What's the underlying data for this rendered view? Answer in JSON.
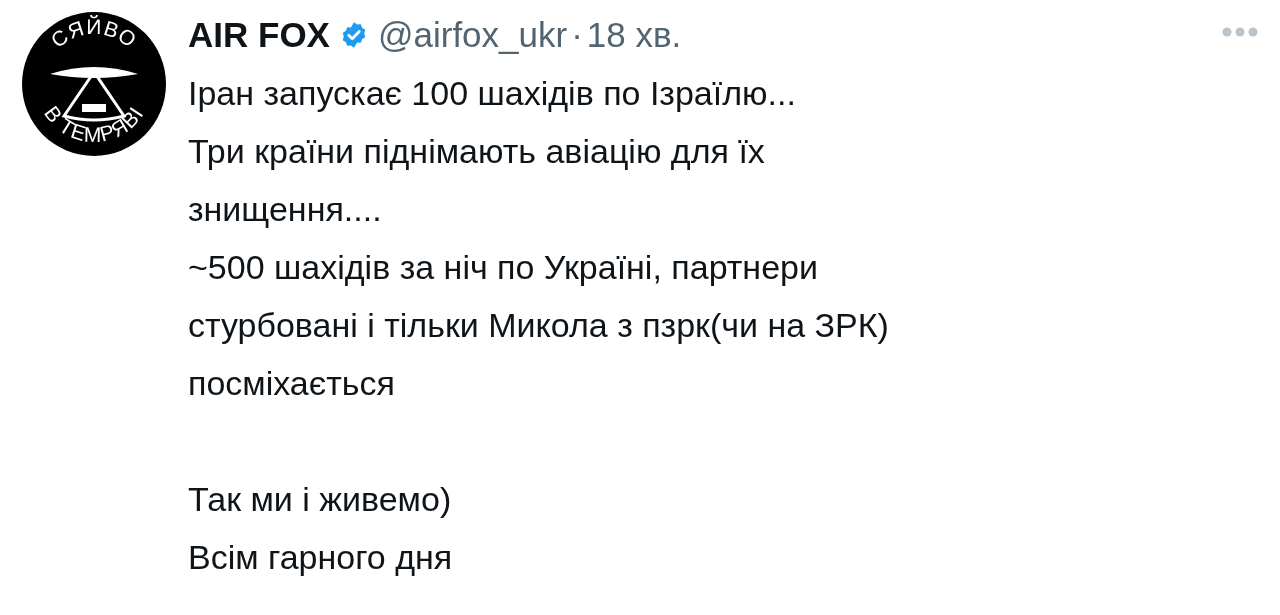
{
  "author": {
    "avatar": {
      "top_text": "СЯЙВО",
      "bottom_text": "В ТЕМРЯВІ"
    },
    "name": "AIR FOX",
    "verified": true,
    "handle": "@airfox_ukr",
    "separator": "·",
    "time": "18 хв."
  },
  "text": "Іран запускає 100 шахідів по Ізраїлю...\nТри країни піднімають авіацію для їх\nзнищення....\n~500 шахідів за ніч по Україні, партнери\nстурбовані і тільки Микола з пзрк(чи на ЗРК)\nпосміхається\n\nТак ми і живемо)\nВсім гарного дня"
}
